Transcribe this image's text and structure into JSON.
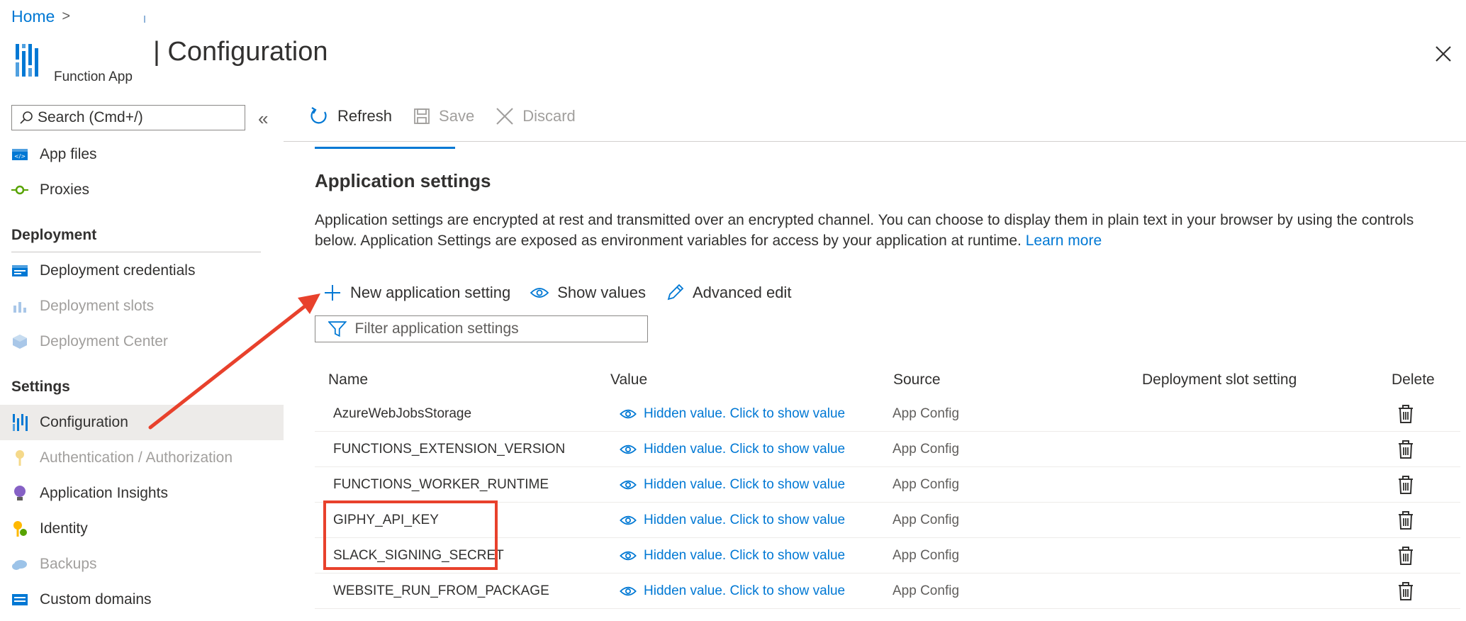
{
  "breadcrumb": {
    "home": "Home",
    "separator": ">"
  },
  "header": {
    "title": "| Configuration",
    "subtitle": "Function App",
    "close_label": "✕"
  },
  "sidebar": {
    "search_placeholder": "Search (Cmd+/)",
    "collapse_label": "«",
    "items_top": [
      {
        "label": "App files",
        "icon": "app-files-icon",
        "disabled": false
      },
      {
        "label": "Proxies",
        "icon": "proxies-icon",
        "disabled": false
      }
    ],
    "deployment_heading": "Deployment",
    "deployment_items": [
      {
        "label": "Deployment credentials",
        "icon": "deployment-credentials-icon",
        "disabled": false
      },
      {
        "label": "Deployment slots",
        "icon": "deployment-slots-icon",
        "disabled": true
      },
      {
        "label": "Deployment Center",
        "icon": "deployment-center-icon",
        "disabled": true
      }
    ],
    "settings_heading": "Settings",
    "settings_items": [
      {
        "label": "Configuration",
        "icon": "configuration-icon",
        "disabled": false,
        "selected": true
      },
      {
        "label": "Authentication / Authorization",
        "icon": "key-icon",
        "disabled": true
      },
      {
        "label": "Application Insights",
        "icon": "lightbulb-icon",
        "disabled": false
      },
      {
        "label": "Identity",
        "icon": "identity-icon",
        "disabled": false
      },
      {
        "label": "Backups",
        "icon": "cloud-icon",
        "disabled": true
      },
      {
        "label": "Custom domains",
        "icon": "custom-domains-icon",
        "disabled": false
      }
    ]
  },
  "toolbar": {
    "refresh_label": "Refresh",
    "save_label": "Save",
    "discard_label": "Discard"
  },
  "main": {
    "section_title": "Application settings",
    "description": "Application settings are encrypted at rest and transmitted over an encrypted channel. You can choose to display them in plain text in your browser by using the controls below. Application Settings are exposed as environment variables for access by your application at runtime.",
    "learn_more": "Learn more",
    "actions": {
      "new_setting": "New application setting",
      "show_values": "Show values",
      "advanced_edit": "Advanced edit"
    },
    "filter_placeholder": "Filter application settings"
  },
  "table": {
    "columns": [
      "Name",
      "Value",
      "Source",
      "Deployment slot setting",
      "Delete"
    ],
    "rows": [
      {
        "name": "AzureWebJobsStorage",
        "value": "Hidden value. Click to show value",
        "source": "App Config"
      },
      {
        "name": "FUNCTIONS_EXTENSION_VERSION",
        "value": "Hidden value. Click to show value",
        "source": "App Config"
      },
      {
        "name": "FUNCTIONS_WORKER_RUNTIME",
        "value": "Hidden value. Click to show value",
        "source": "App Config"
      },
      {
        "name": "GIPHY_API_KEY",
        "value": "Hidden value. Click to show value",
        "source": "App Config"
      },
      {
        "name": "SLACK_SIGNING_SECRET",
        "value": "Hidden value. Click to show value",
        "source": "App Config"
      },
      {
        "name": "WEBSITE_RUN_FROM_PACKAGE",
        "value": "Hidden value. Click to show value",
        "source": "App Config"
      }
    ]
  },
  "colors": {
    "accent": "#0078d4",
    "annotation": "#e8412c",
    "selected_bg": "#edebe9"
  }
}
